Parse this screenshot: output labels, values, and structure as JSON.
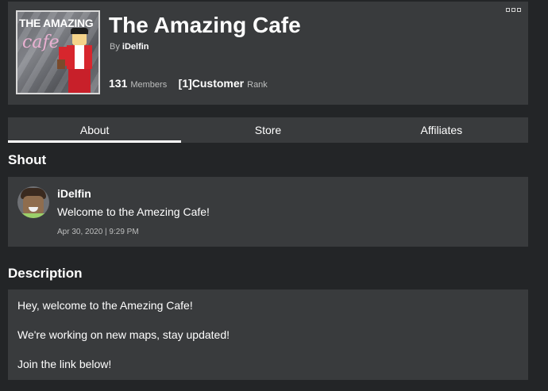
{
  "group": {
    "title": "The Amazing Cafe",
    "owner_prefix": "By",
    "owner": "iDelfin",
    "members_count": "131",
    "members_label": "Members",
    "rank_value": "[1]Customer",
    "rank_label": "Rank",
    "emblem_text": "THE AMAZING",
    "emblem_script": "cafe"
  },
  "tabs": [
    {
      "label": "About",
      "active": true
    },
    {
      "label": "Store",
      "active": false
    },
    {
      "label": "Affiliates",
      "active": false
    }
  ],
  "shout": {
    "section_title": "Shout",
    "author": "iDelfin",
    "message": "Welcome to the Amezing Cafe!",
    "timestamp": "Apr 30, 2020 | 9:29 PM"
  },
  "description": {
    "section_title": "Description",
    "lines": [
      "Hey, welcome to the Amezing Cafe!",
      "We're working on new maps, stay updated!",
      "Join the link below!"
    ]
  },
  "icons": {
    "more_menu": "more-options-icon"
  },
  "colors": {
    "background": "#232527",
    "card": "#393b3d",
    "text": "#ffffff",
    "muted_text": "#bdbebe"
  }
}
